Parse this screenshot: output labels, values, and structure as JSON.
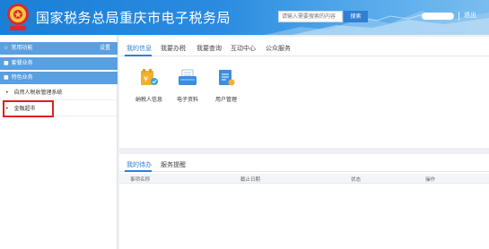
{
  "header": {
    "site_title": "国家税务总局重庆市电子税务局",
    "search_placeholder": "请输入需要搜索的内容",
    "search_button": "搜索",
    "logout": "退出"
  },
  "sidebar": {
    "common": {
      "label": "常用功能",
      "action": "设置"
    },
    "heading_business": "套餐业务",
    "heading_special": "特色业务",
    "items": [
      {
        "label": "自然人税收管理系统"
      },
      {
        "label": "金融超市"
      }
    ]
  },
  "top_tabs": [
    "我的信息",
    "我要办税",
    "我要查询",
    "互动中心",
    "公众服务"
  ],
  "apps": [
    {
      "label": "纳税人信息",
      "icon": "taxpayer-info-icon"
    },
    {
      "label": "电子资料",
      "icon": "e-documents-icon"
    },
    {
      "label": "用户管理",
      "icon": "user-management-icon"
    }
  ],
  "bottom_tabs": [
    "我的待办",
    "服务提醒"
  ],
  "table": {
    "columns": [
      "事项名称",
      "截止日期",
      "状态",
      "操作"
    ]
  },
  "colors": {
    "header_blue": "#1b7fd6",
    "accent": "#2f7fd3",
    "highlight_red": "#e02020"
  }
}
